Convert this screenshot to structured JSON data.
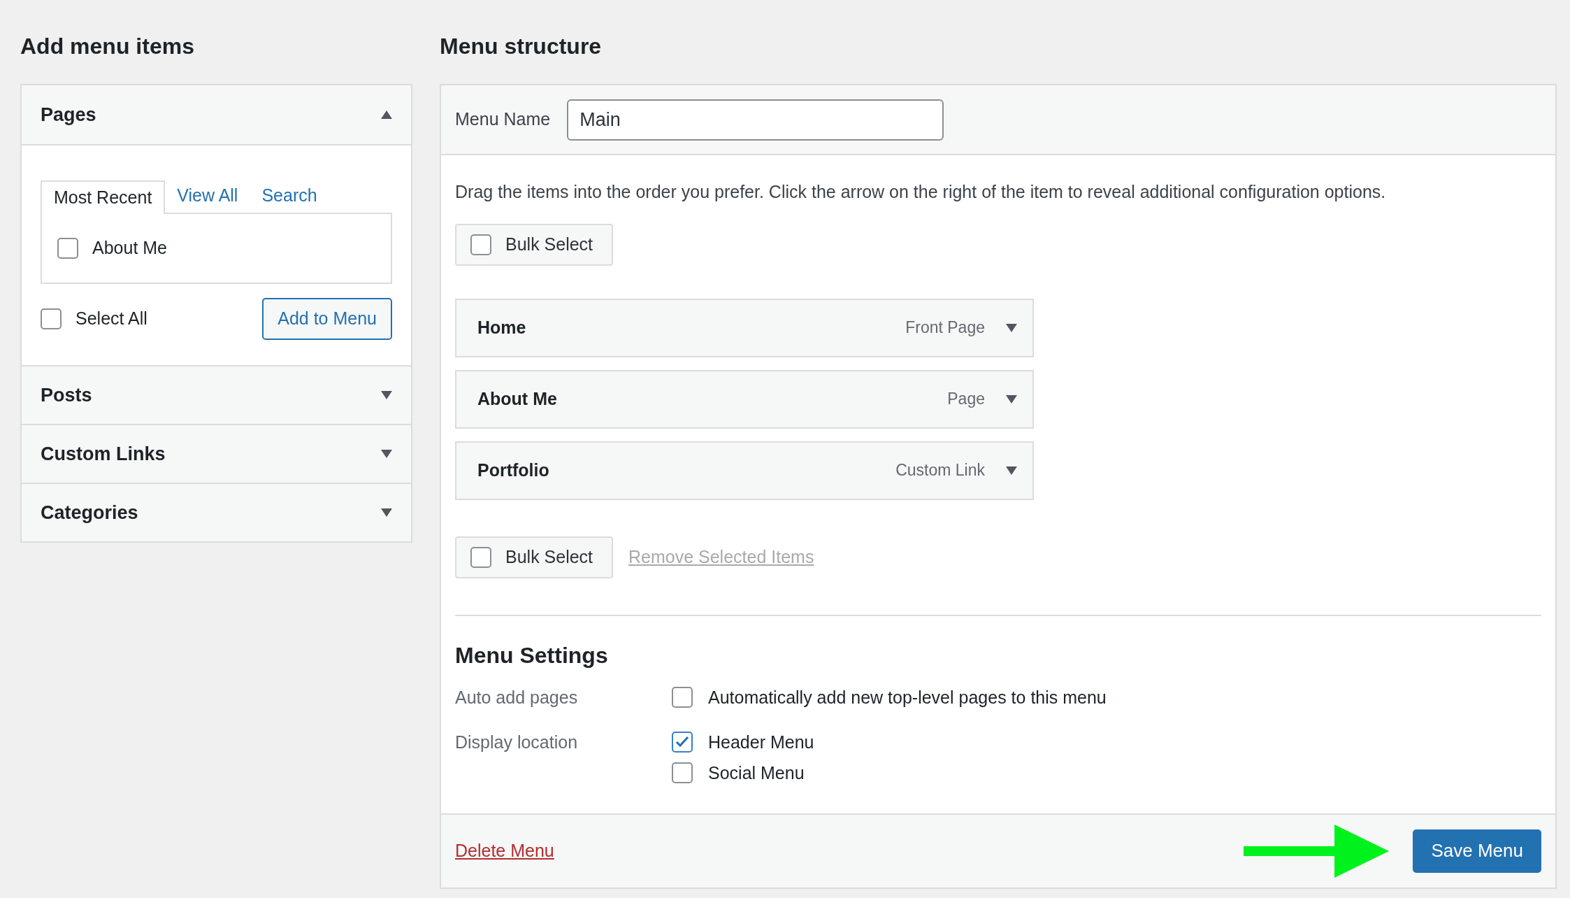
{
  "add_menu_items": {
    "title": "Add menu items",
    "sections": [
      {
        "title": "Pages",
        "expanded": true,
        "tabs": [
          {
            "label": "Most Recent",
            "selected": true
          },
          {
            "label": "View All",
            "selected": false
          },
          {
            "label": "Search",
            "selected": false
          }
        ],
        "items": [
          {
            "label": "About Me",
            "checked": false
          }
        ],
        "select_all": {
          "label": "Select All",
          "checked": false
        },
        "button": "Add to Menu"
      },
      {
        "title": "Posts",
        "expanded": false
      },
      {
        "title": "Custom Links",
        "expanded": false
      },
      {
        "title": "Categories",
        "expanded": false
      }
    ]
  },
  "menu_structure": {
    "title": "Menu structure",
    "menu_name": {
      "label": "Menu Name",
      "value": "Main"
    },
    "instructions": "Drag the items into the order you prefer. Click the arrow on the right of the item to reveal additional configuration options.",
    "bulk_select_top": {
      "label": "Bulk Select",
      "checked": false
    },
    "items": [
      {
        "title": "Home",
        "type": "Front Page"
      },
      {
        "title": "About Me",
        "type": "Page"
      },
      {
        "title": "Portfolio",
        "type": "Custom Link"
      }
    ],
    "bulk_select_bottom": {
      "label": "Bulk Select",
      "checked": false
    },
    "remove_link": {
      "label": "Remove Selected Items",
      "disabled": true
    },
    "settings": {
      "title": "Menu Settings",
      "rows": [
        {
          "label": "Auto add pages",
          "options": [
            {
              "label": "Automatically add new top-level pages to this menu",
              "checked": false
            }
          ]
        },
        {
          "label": "Display location",
          "options": [
            {
              "label": "Header Menu",
              "checked": true
            },
            {
              "label": "Social Menu",
              "checked": false
            }
          ]
        }
      ]
    },
    "delete_link": "Delete Menu",
    "save_button": "Save Menu"
  }
}
